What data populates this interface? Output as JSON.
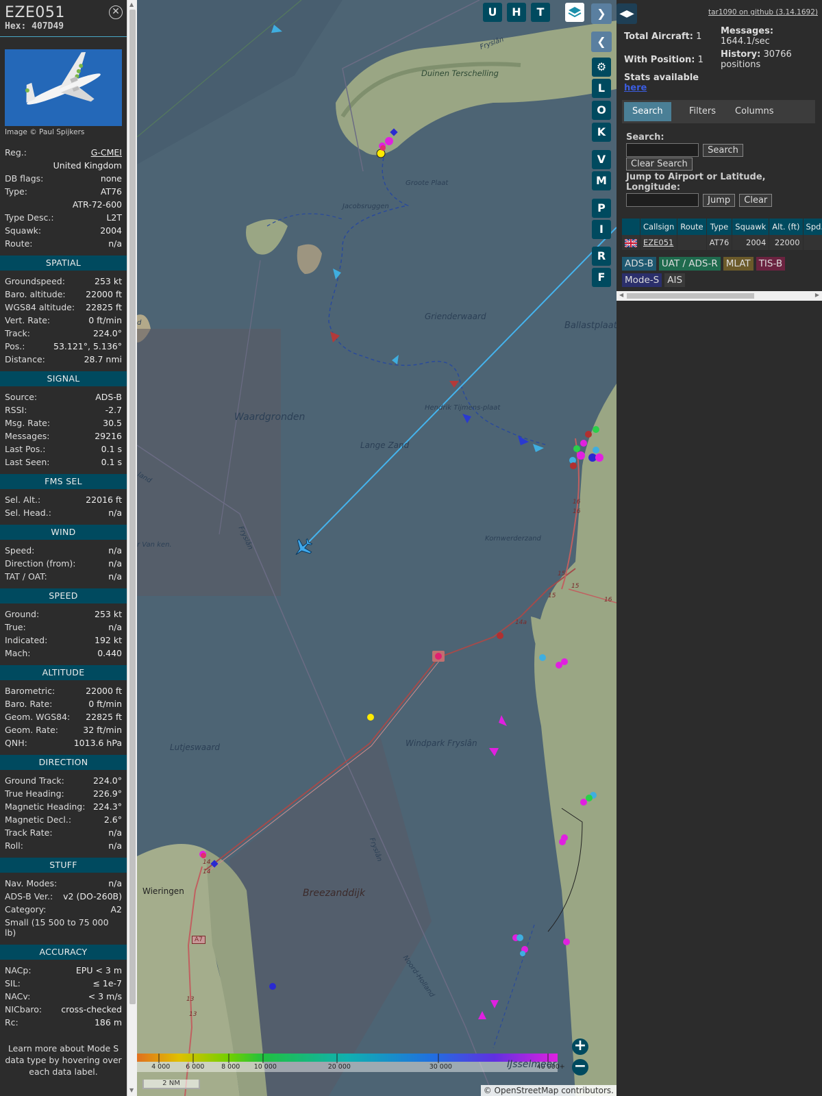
{
  "aircraft": {
    "callsign": "EZE051",
    "hex": "Hex: 407D49",
    "photo_credit": "Image © Paul Spijkers",
    "info_rows": [
      {
        "k": "Reg.:",
        "v": "G-CMEI",
        "u": true
      },
      {
        "k": "",
        "v": "United Kingdom"
      },
      {
        "k": "DB flags:",
        "v": "none"
      },
      {
        "k": "Type:",
        "v": "AT76"
      },
      {
        "k": "",
        "v": "ATR-72-600"
      },
      {
        "k": "Type Desc.:",
        "v": "L2T"
      },
      {
        "k": "Squawk:",
        "v": "2004"
      },
      {
        "k": "Route:",
        "v": "n/a"
      }
    ]
  },
  "sections": [
    {
      "title": "SPATIAL",
      "rows": [
        {
          "k": "Groundspeed:",
          "v": "253 kt"
        },
        {
          "k": "Baro. altitude:",
          "v": "22000 ft"
        },
        {
          "k": "WGS84 altitude:",
          "v": "22825 ft"
        },
        {
          "k": "Vert. Rate:",
          "v": "0 ft/min"
        },
        {
          "k": "Track:",
          "v": "224.0°"
        },
        {
          "k": "Pos.:",
          "v": "53.121°, 5.136°"
        },
        {
          "k": "Distance:",
          "v": "28.7 nmi"
        }
      ]
    },
    {
      "title": "SIGNAL",
      "rows": [
        {
          "k": "Source:",
          "v": "ADS-B"
        },
        {
          "k": "RSSI:",
          "v": "-2.7"
        },
        {
          "k": "Msg. Rate:",
          "v": "30.5"
        },
        {
          "k": "Messages:",
          "v": "29216"
        },
        {
          "k": "Last Pos.:",
          "v": "0.1 s"
        },
        {
          "k": "Last Seen:",
          "v": "0.1 s"
        }
      ]
    },
    {
      "title": "FMS SEL",
      "rows": [
        {
          "k": "Sel. Alt.:",
          "v": "22016 ft"
        },
        {
          "k": "Sel. Head.:",
          "v": "n/a"
        }
      ]
    },
    {
      "title": "WIND",
      "rows": [
        {
          "k": "Speed:",
          "v": "n/a"
        },
        {
          "k": "Direction (from):",
          "v": "n/a"
        },
        {
          "k": "TAT / OAT:",
          "v": "n/a"
        }
      ]
    },
    {
      "title": "SPEED",
      "rows": [
        {
          "k": "Ground:",
          "v": "253 kt"
        },
        {
          "k": "True:",
          "v": "n/a"
        },
        {
          "k": "Indicated:",
          "v": "192 kt"
        },
        {
          "k": "Mach:",
          "v": "0.440"
        }
      ]
    },
    {
      "title": "ALTITUDE",
      "rows": [
        {
          "k": "Barometric:",
          "v": "22000 ft"
        },
        {
          "k": "Baro. Rate:",
          "v": "0 ft/min"
        },
        {
          "k": "Geom. WGS84:",
          "v": "22825 ft"
        },
        {
          "k": "Geom. Rate:",
          "v": "32 ft/min"
        },
        {
          "k": "QNH:",
          "v": "1013.6 hPa"
        }
      ]
    },
    {
      "title": "DIRECTION",
      "rows": [
        {
          "k": "Ground Track:",
          "v": "224.0°"
        },
        {
          "k": "True Heading:",
          "v": "226.9°"
        },
        {
          "k": "Magnetic Heading:",
          "v": "224.3°"
        },
        {
          "k": "Magnetic Decl.:",
          "v": "2.6°"
        },
        {
          "k": "Track Rate:",
          "v": "n/a"
        },
        {
          "k": "Roll:",
          "v": "n/a"
        }
      ]
    },
    {
      "title": "STUFF",
      "rows": [
        {
          "k": "Nav. Modes:",
          "v": "n/a"
        },
        {
          "k": "ADS-B Ver.:",
          "v": "v2 (DO-260B)"
        },
        {
          "k": "Category:",
          "v": "A2"
        },
        {
          "k": "Small (15 500 to 75 000 lb)",
          "v": "",
          "wrap": true
        }
      ]
    },
    {
      "title": "ACCURACY",
      "rows": [
        {
          "k": "NACp:",
          "v": "EPU < 3 m"
        },
        {
          "k": "SIL:",
          "v": "≤ 1e-7"
        },
        {
          "k": "NACv:",
          "v": "< 3 m/s"
        },
        {
          "k": "NICbaro:",
          "v": "cross-checked"
        },
        {
          "k": "Rc:",
          "v": "186 m"
        }
      ]
    }
  ],
  "footer_note": "Learn more about Mode S data type by hovering over each data label.",
  "map": {
    "layer_buttons": [
      "U",
      "H",
      "T"
    ],
    "side_buttons": [
      "L",
      "O",
      "K",
      "V",
      "M",
      "P",
      "I",
      "R",
      "F"
    ],
    "labels": {
      "duinen": "Duinen Terschelling",
      "fryslan1": "Fryslân",
      "groote": "Groote Plaat",
      "jacobsruggen": "Jacobsruggen",
      "grienderwaard": "Grienderwaard",
      "ballastplaat": "Ballastplaat",
      "waardgronden": "Waardgronden",
      "hendrik": "Hendrik Tijmens-plaat",
      "langezand": "Lange Zand",
      "kornwerderzand": "Kornwerderzand",
      "windpark": "Windpark Fryslân",
      "lutjeswaard": "Lutjeswaard",
      "breezanddijk": "Breezanddijk",
      "wieringen": "Wieringen",
      "noordholland": "Noord-Holland",
      "fryslan2": "Fryslân",
      "fryslan3": "Fryslân",
      "ijsselmeer": "IJsselmeer",
      "vanken": "r Van ken.",
      "land": "land",
      "d": "d"
    },
    "road_labels": [
      "16",
      "16",
      "15",
      "15",
      "15",
      "16",
      "14a",
      "14",
      "14",
      "A7",
      "13",
      "13"
    ],
    "colorbar_ticks": [
      "4 000",
      "6 000",
      "8 000",
      "10 000",
      "20 000",
      "30 000",
      "40 000+"
    ],
    "scale": "2 NM",
    "attribution": "© OpenStreetMap contributors."
  },
  "right": {
    "github": "tar1090 on github (3.14.1692)",
    "total_aircraft_label": "Total Aircraft:",
    "total_aircraft": "1",
    "with_position_label": "With Position:",
    "with_position": "1",
    "messages_label": "Messages:",
    "messages": "1644.1/sec",
    "history_label": "History:",
    "history": "30766 positions",
    "stats_label": "Stats available",
    "stats_link": "here",
    "tabs": [
      "Search",
      "Filters",
      "Columns"
    ],
    "search_label": "Search:",
    "search_btn": "Search",
    "clear_search_btn": "Clear Search",
    "jump_label": "Jump to Airport or Latitude, Longitude:",
    "jump_btn": "Jump",
    "clear_btn": "Clear",
    "table_headers": [
      "",
      "Callsign",
      "Route",
      "Type",
      "Squawk",
      "Alt. (ft)",
      "Spd."
    ],
    "table_row": [
      "",
      "EZE051",
      "",
      "AT76",
      "2004",
      "22000",
      ""
    ],
    "sources": [
      {
        "label": "ADS-B",
        "color": "#1e5870"
      },
      {
        "label": "UAT / ADS-R",
        "color": "#1f6b4e"
      },
      {
        "label": "MLAT",
        "color": "#6b5a2a"
      },
      {
        "label": "TIS-B",
        "color": "#6b2340"
      },
      {
        "label": "Mode-S",
        "color": "#2b2f6b"
      },
      {
        "label": "AIS",
        "color": "#3a3a3a"
      }
    ]
  }
}
